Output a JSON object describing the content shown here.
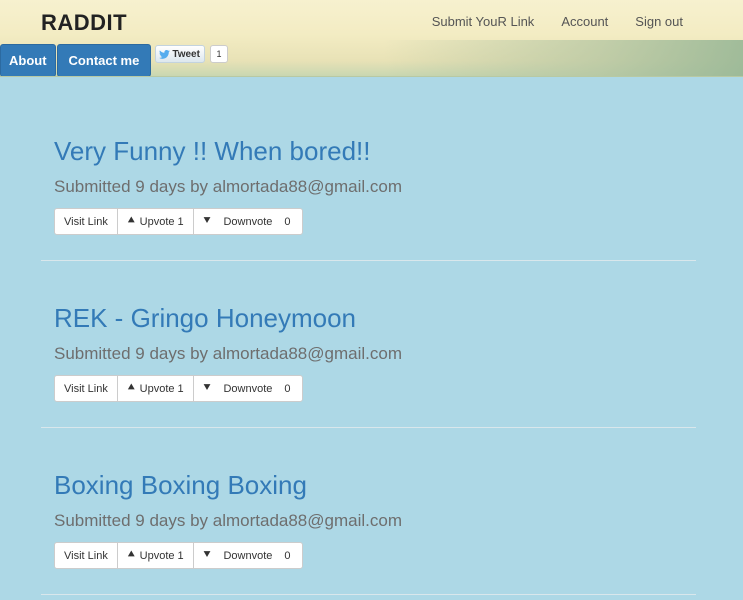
{
  "header": {
    "brand": "RADDIT",
    "nav": {
      "submit": "Submit YouR Link",
      "account": "Account",
      "signout": "Sign out"
    },
    "about": "About",
    "contact": "Contact me",
    "tweet_label": "Tweet",
    "tweet_count": "1"
  },
  "posts": [
    {
      "title": "Very Funny !! When bored!!",
      "meta": "Submitted 9 days by almortada88@gmail.com",
      "visit": "Visit Link",
      "upvote": "Upvote 1",
      "downvote": "Downvote",
      "down_count": "0"
    },
    {
      "title": "REK - Gringo Honeymoon",
      "meta": "Submitted 9 days by almortada88@gmail.com",
      "visit": "Visit Link",
      "upvote": "Upvote 1",
      "downvote": "Downvote",
      "down_count": "0"
    },
    {
      "title": "Boxing Boxing Boxing",
      "meta": "Submitted 9 days by almortada88@gmail.com",
      "visit": "Visit Link",
      "upvote": "Upvote 1",
      "downvote": "Downvote",
      "down_count": "0"
    }
  ],
  "icons": {
    "up": "chevron-up-icon",
    "down": "chevron-down-icon",
    "twitter": "twitter-bird-icon"
  },
  "colors": {
    "page_bg": "#add8e6",
    "link_blue": "#337ab7"
  }
}
